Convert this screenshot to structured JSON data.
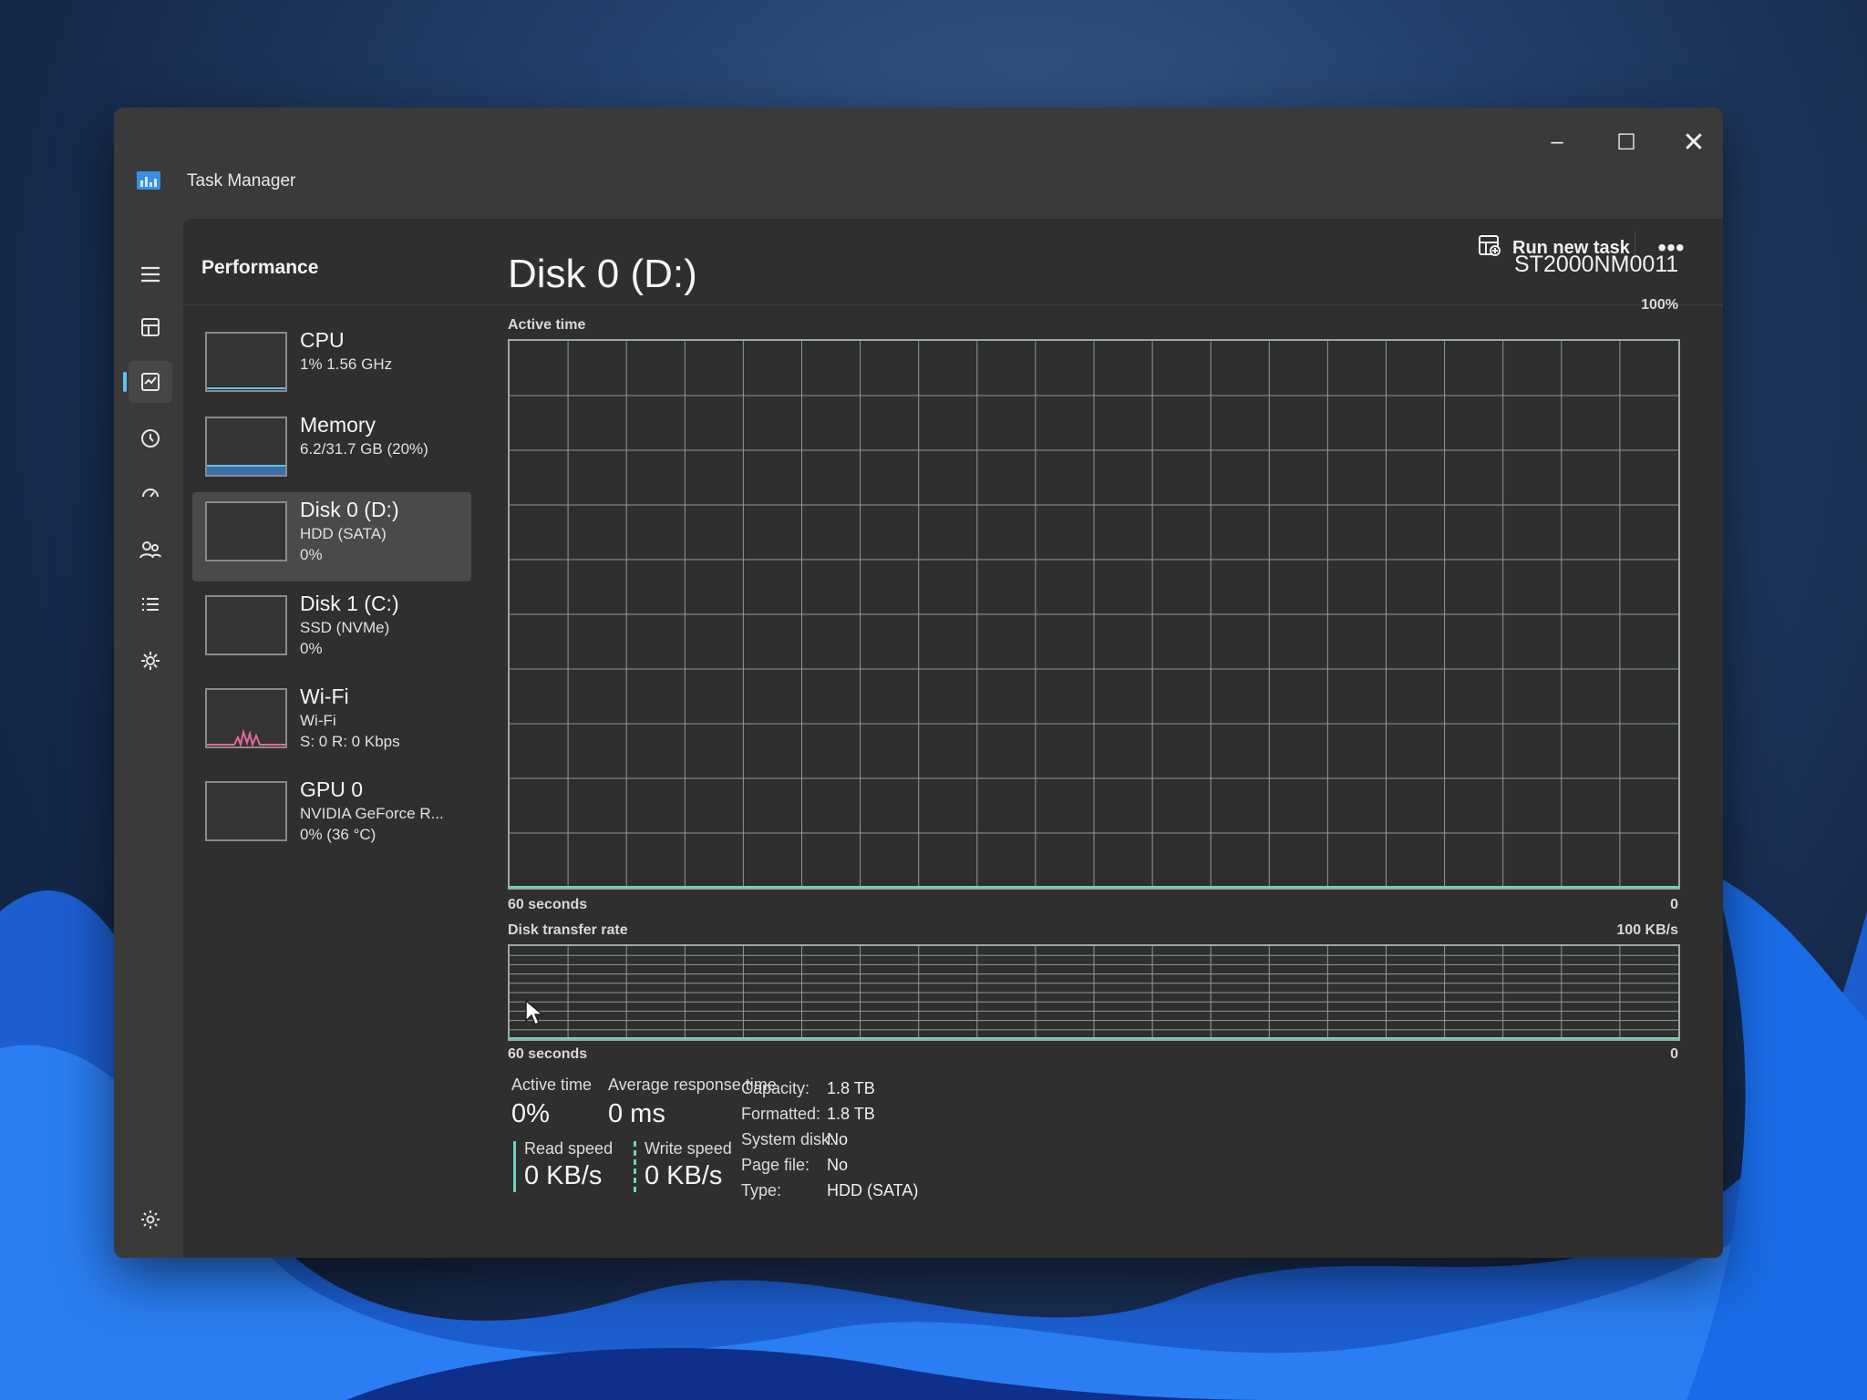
{
  "colors": {
    "window_bg": "#3a3a3a",
    "content_bg": "#2f2f2f",
    "graph_grid": "#8e9a96",
    "accent": "#5cc2f2",
    "disk_line": "#6fd3c2",
    "wifi_line": "#e0699b"
  },
  "window": {
    "title": "Task Manager",
    "app_icon": "task-manager-icon",
    "controls": {
      "minimize": "–",
      "maximize": "☐",
      "close": "✕"
    }
  },
  "nav": {
    "items": [
      {
        "icon": "hamburger-menu-icon"
      },
      {
        "icon": "processes-icon"
      },
      {
        "icon": "performance-icon",
        "active": true
      },
      {
        "icon": "app-history-icon"
      },
      {
        "icon": "startup-apps-icon"
      },
      {
        "icon": "users-icon"
      },
      {
        "icon": "details-icon"
      },
      {
        "icon": "services-icon"
      }
    ],
    "settings_icon": "settings-gear-icon"
  },
  "header": {
    "page_title": "Performance",
    "run_new_task": "Run new task",
    "more": "•••"
  },
  "resources": [
    {
      "name": "CPU",
      "sub1": "1% 1.56 GHz",
      "sub2": ""
    },
    {
      "name": "Memory",
      "sub1": "6.2/31.7 GB (20%)",
      "sub2": ""
    },
    {
      "name": "Disk 0 (D:)",
      "sub1": "HDD (SATA)",
      "sub2": "0%",
      "selected": true
    },
    {
      "name": "Disk 1 (C:)",
      "sub1": "SSD (NVMe)",
      "sub2": "0%"
    },
    {
      "name": "Wi-Fi",
      "sub1": "Wi-Fi",
      "sub2": "S: 0 R: 0 Kbps"
    },
    {
      "name": "GPU 0",
      "sub1": "NVIDIA GeForce R...",
      "sub2": "0% (36 °C)"
    }
  ],
  "detail": {
    "title": "Disk 0 (D:)",
    "model": "ST2000NM0011",
    "active_graph": {
      "label": "Active time",
      "max": "100%",
      "min": "0",
      "time_span": "60 seconds",
      "value_percent": 0
    },
    "transfer_graph": {
      "label": "Disk transfer rate",
      "max": "100 KB/s",
      "min": "0",
      "time_span": "60 seconds",
      "value": 0
    },
    "stats": {
      "active_time_label": "Active time",
      "active_time_value": "0%",
      "avg_response_label": "Average response time",
      "avg_response_value": "0 ms",
      "read_speed_label": "Read speed",
      "read_speed_value": "0 KB/s",
      "write_speed_label": "Write speed",
      "write_speed_value": "0 KB/s"
    },
    "properties": [
      {
        "key": "Capacity:",
        "value": "1.8 TB"
      },
      {
        "key": "Formatted:",
        "value": "1.8 TB"
      },
      {
        "key": "System disk:",
        "value": "No"
      },
      {
        "key": "Page file:",
        "value": "No"
      },
      {
        "key": "Type:",
        "value": "HDD (SATA)"
      }
    ]
  }
}
